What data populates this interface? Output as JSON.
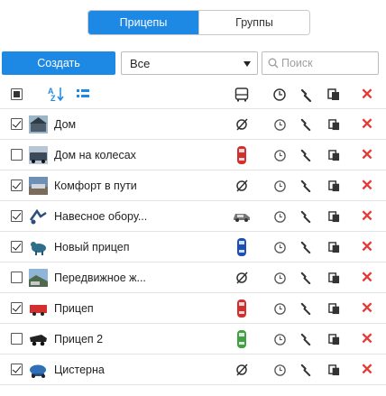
{
  "tabs": [
    {
      "label": "Прицепы",
      "active": true
    },
    {
      "label": "Группы",
      "active": false
    }
  ],
  "toolbar": {
    "create_label": "Создать",
    "filter_value": "Все",
    "search_placeholder": "Поиск"
  },
  "colors": {
    "accent": "#1e88e5",
    "delete": "#e53935"
  },
  "header_icons": [
    "select-all-checkbox",
    "sort-az-icon",
    "group-icon",
    "vehicle-icon",
    "history-icon",
    "tools-icon",
    "copy-icon",
    "delete-icon"
  ],
  "rows": [
    {
      "name": "Дом",
      "checked": true,
      "thumb": "house-thumb",
      "link": "unlinked"
    },
    {
      "name": "Дом на колесах",
      "checked": false,
      "thumb": "rv-thumb",
      "link": "linked-red"
    },
    {
      "name": "Комфорт в пути",
      "checked": true,
      "thumb": "road-thumb",
      "link": "unlinked"
    },
    {
      "name": "Навесное обору...",
      "checked": true,
      "thumb": "equipment-thumb",
      "link": "linked-car"
    },
    {
      "name": "Новый прицеп",
      "checked": true,
      "thumb": "animal-thumb",
      "link": "linked-blue"
    },
    {
      "name": "Передвижное ж...",
      "checked": false,
      "thumb": "landscape-thumb",
      "link": "unlinked"
    },
    {
      "name": "Прицеп",
      "checked": true,
      "thumb": "red-trailer-thumb",
      "link": "linked-red"
    },
    {
      "name": "Прицеп 2",
      "checked": false,
      "thumb": "black-trailer-thumb",
      "link": "linked-green"
    },
    {
      "name": "Цистерна",
      "checked": true,
      "thumb": "tank-thumb",
      "link": "unlinked"
    }
  ]
}
